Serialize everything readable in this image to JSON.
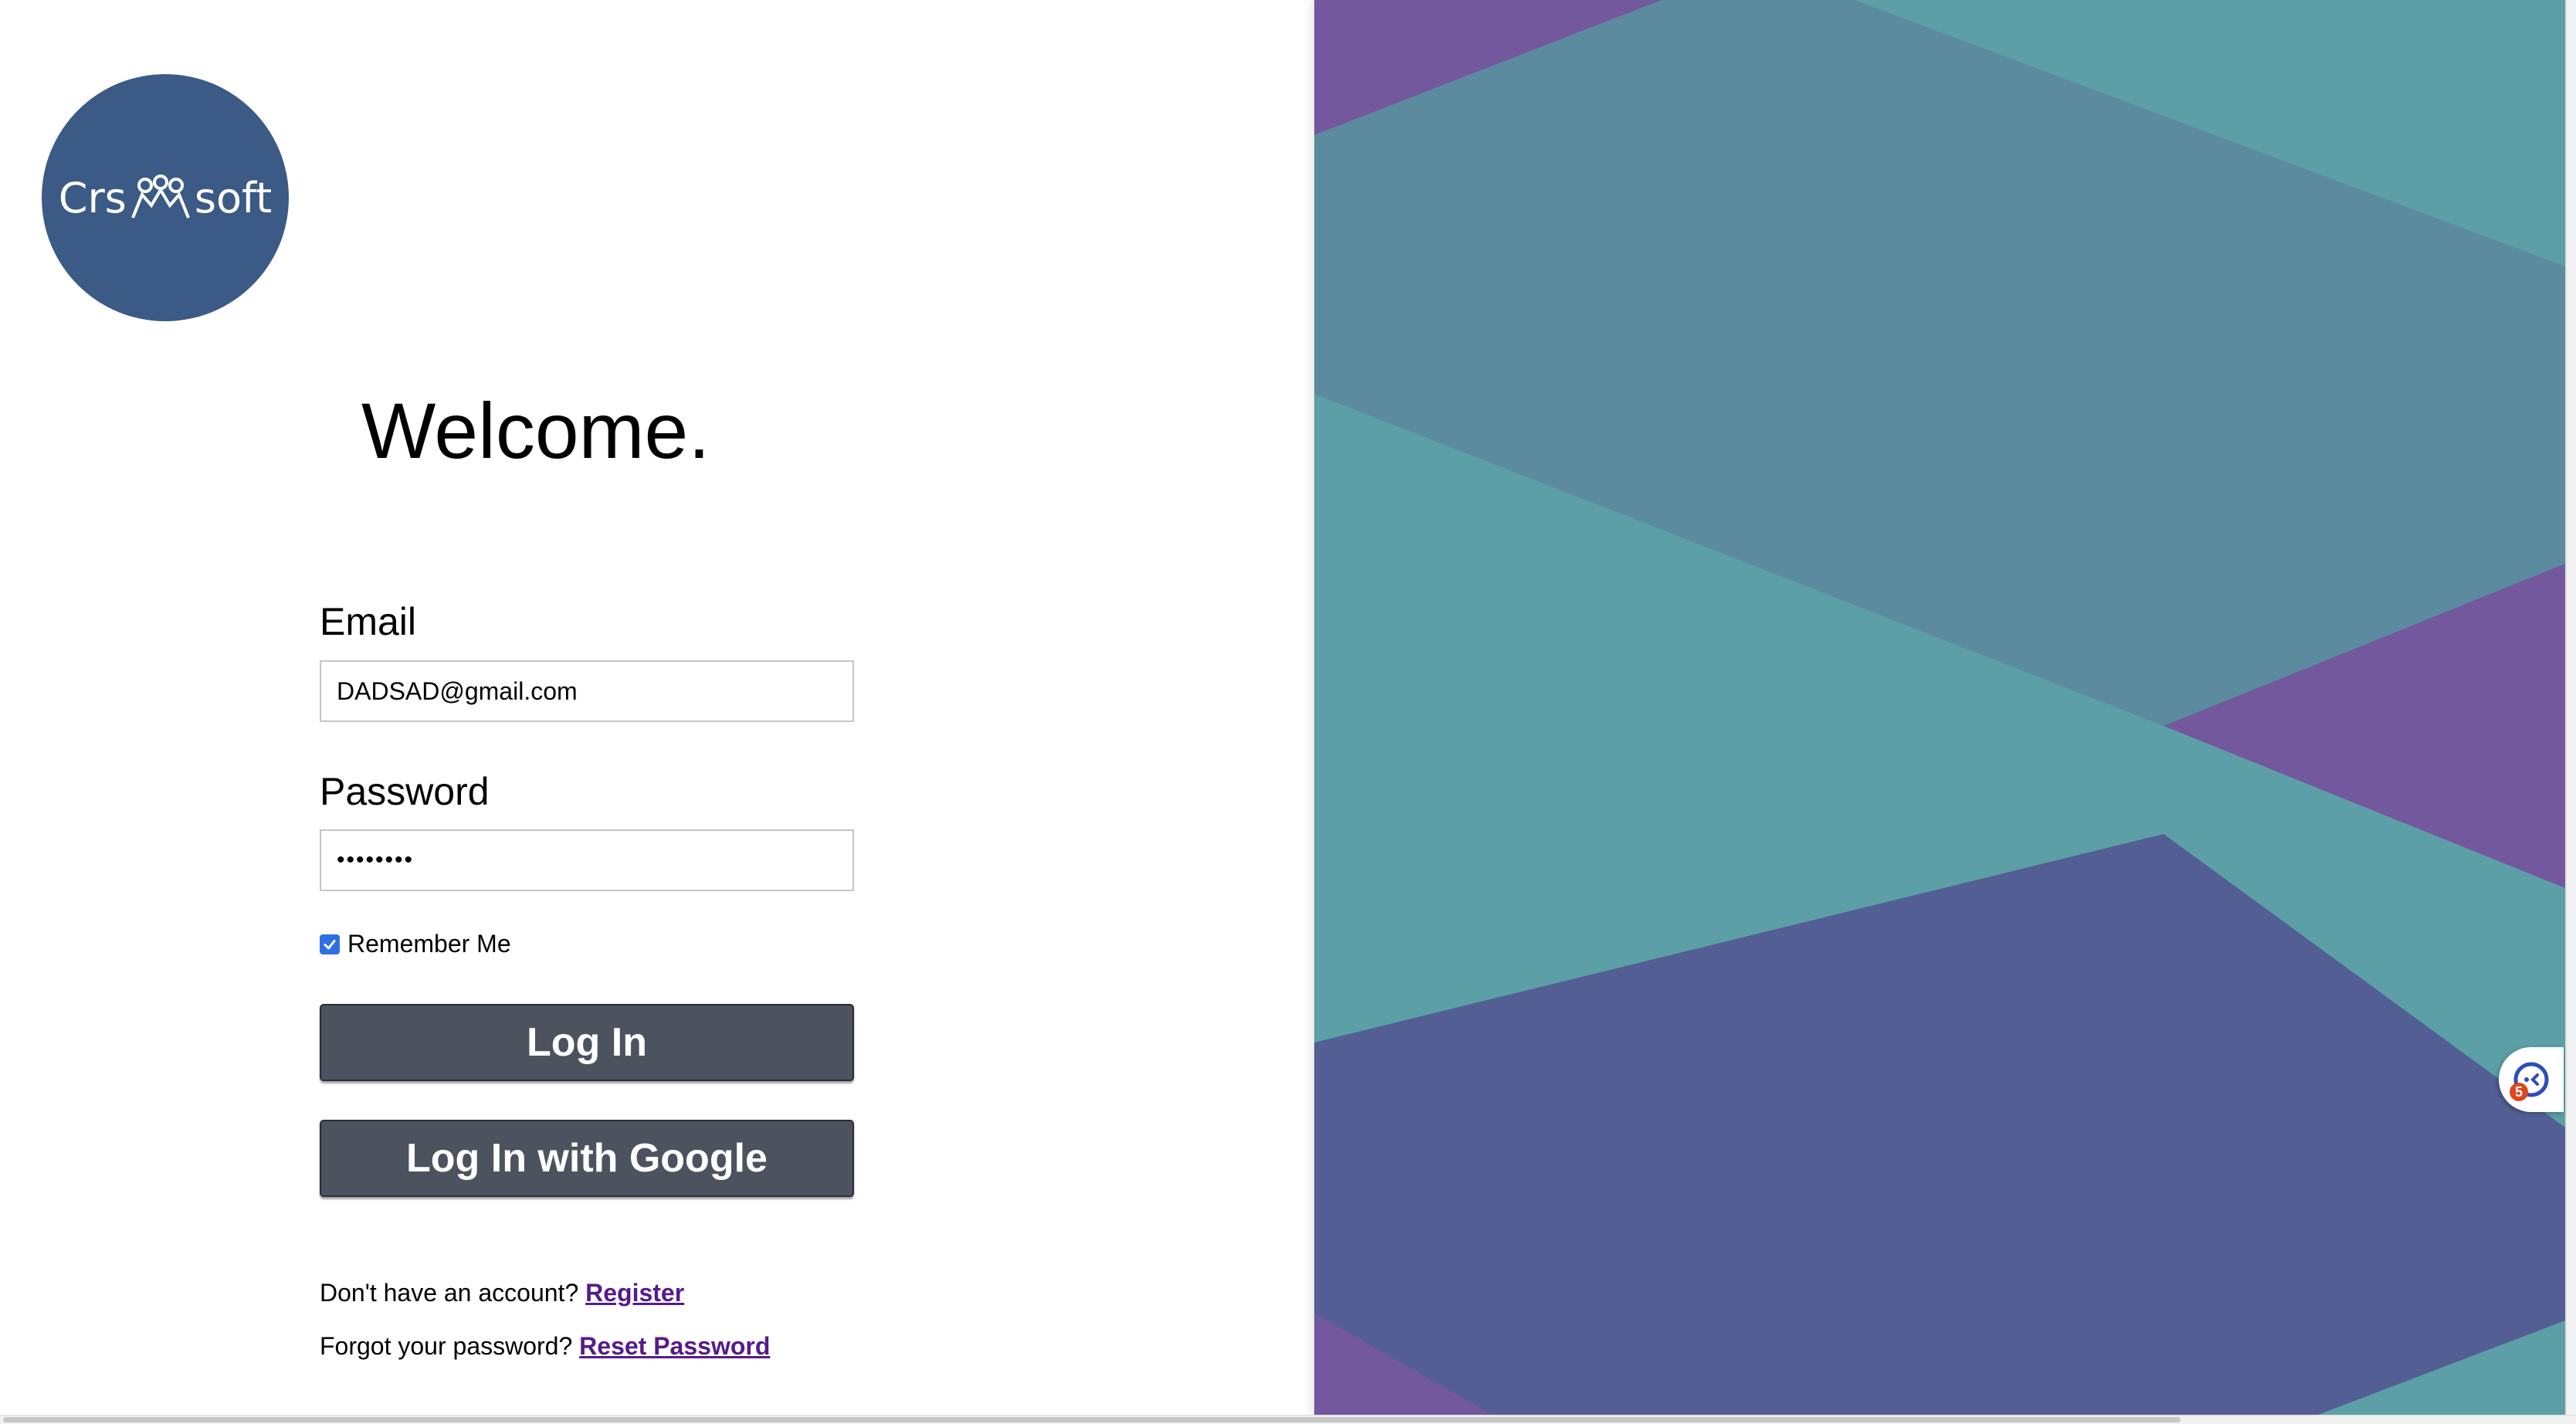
{
  "brand": {
    "logo_text_left": "Crs",
    "logo_text_right": "soft",
    "logo_color": "#3c5a86",
    "logo_icon": "people-group-icon"
  },
  "welcome": "Welcome.",
  "form": {
    "email_label": "Email",
    "email_value": "DADSAD@gmail.com",
    "password_label": "Password",
    "password_value": "••••••••",
    "remember_label": "Remember Me",
    "remember_checked": true,
    "login_button": "Log In",
    "google_button": "Log In with Google"
  },
  "footer": {
    "register_prompt": "Don't have an account?",
    "register_link": "Register",
    "reset_prompt": "Forgot your password?",
    "reset_link": "Reset Password"
  },
  "widget": {
    "icon": "chat-assistant-icon",
    "badge": "5"
  },
  "colors": {
    "button_bg": "#4c535f",
    "link": "#551a8b",
    "checkbox": "#2f6fe4",
    "teal": "#5c9fa6",
    "slate": "#5c8a9e",
    "indigo": "#535e95",
    "purple": "#73589e"
  }
}
